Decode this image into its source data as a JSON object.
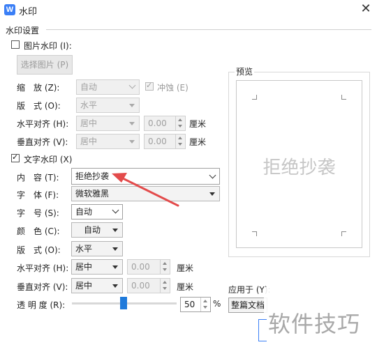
{
  "window": {
    "title": "水印",
    "app_icon_letter": "W",
    "close_symbol": "✕"
  },
  "settings": {
    "section_title": "水印设置",
    "picture_watermark": {
      "checkbox_label": "图片水印 (I):",
      "checked": false,
      "select_picture_button": "选择图片 (P)",
      "scale_label": "缩　放 (Z):",
      "scale_value": "自动",
      "washout_label": "冲蚀 (E)",
      "washout_checked": true,
      "layout_label": "版　式 (O):",
      "layout_value": "水平",
      "halign_label": "水平对齐 (H):",
      "halign_value": "居中",
      "halign_offset": "0.00",
      "valign_label": "垂直对齐 (V):",
      "valign_value": "居中",
      "valign_offset": "0.00",
      "unit": "厘米"
    },
    "text_watermark": {
      "checkbox_label": "文字水印 (X)",
      "checked": true,
      "content_label": "内　容 (T):",
      "content_value": "拒绝抄袭",
      "font_label": "字　体 (F):",
      "font_value": "微软雅黑",
      "size_label": "字　号 (S):",
      "size_value": "自动",
      "color_label": "颜　色 (C):",
      "color_value": "自动",
      "layout_label": "版　式 (O):",
      "layout_value": "水平",
      "halign_label": "水平对齐 (H):",
      "halign_value": "居中",
      "halign_offset": "0.00",
      "valign_label": "垂直对齐 (V):",
      "valign_value": "居中",
      "valign_offset": "0.00",
      "unit": "厘米",
      "transparency_label": "透 明 度 (R):",
      "transparency_value": "50",
      "transparency_unit": "%"
    }
  },
  "preview": {
    "label": "预览",
    "watermark_text": "拒绝抄袭"
  },
  "apply_to": {
    "label": "应用于 (Y):",
    "value": "整篇文档"
  },
  "overlay": {
    "site_watermark": "软件技巧"
  },
  "colors": {
    "accent": "#1f7adb",
    "annotation_arrow": "#e34b4b",
    "app_icon": "#3b7ff6"
  }
}
